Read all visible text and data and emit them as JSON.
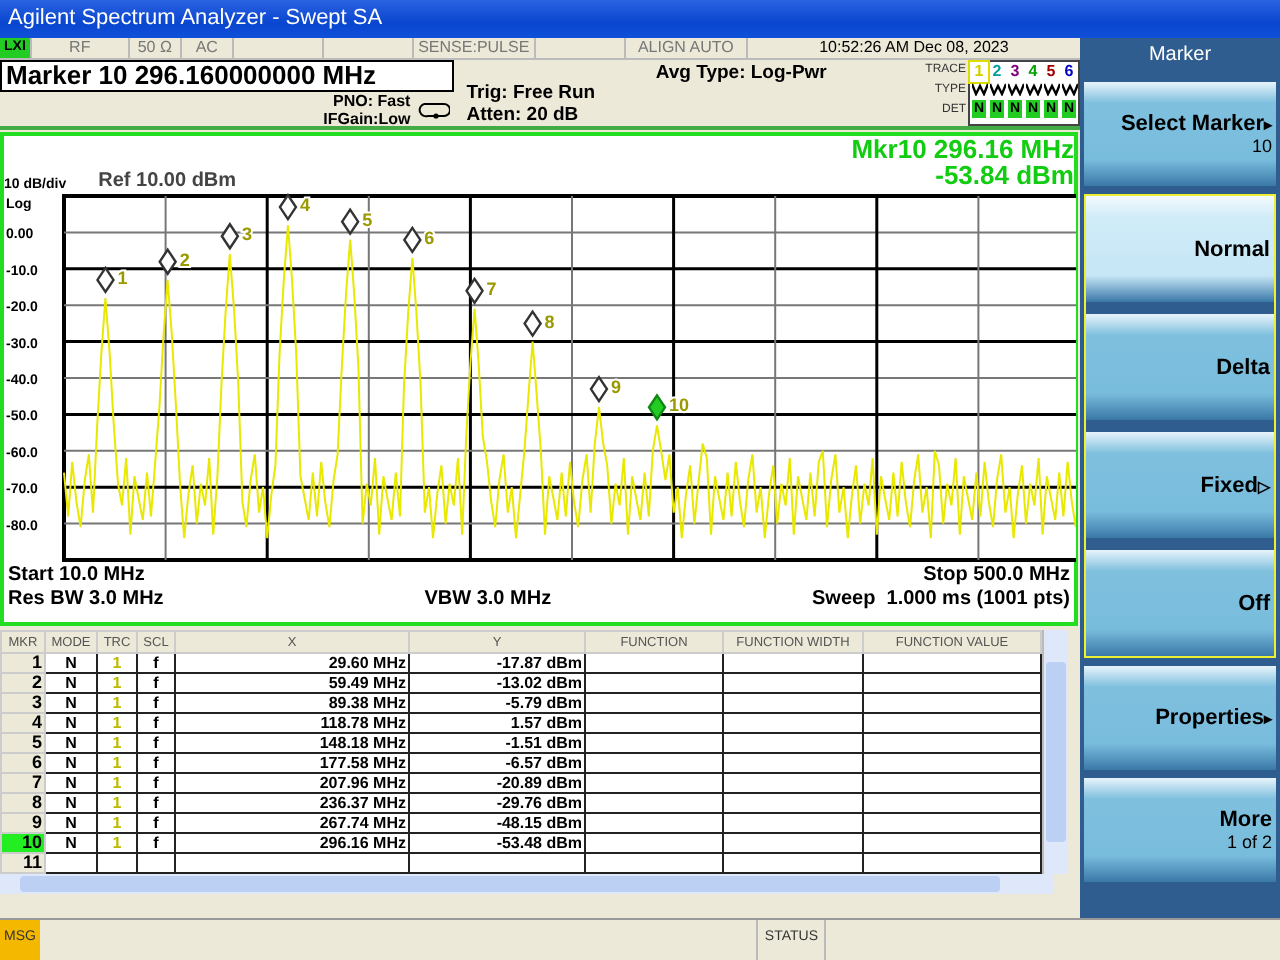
{
  "window": {
    "title": "Agilent Spectrum Analyzer - Swept SA"
  },
  "status_row": {
    "lxi": "LXI",
    "input": "RF",
    "impedance": "50 Ω",
    "coupling": "AC",
    "sense": "SENSE:PULSE",
    "align": "ALIGN AUTO",
    "datetime": "10:52:26 AM Dec 08, 2023"
  },
  "marker_readout": "Marker 10 296.160000000 MHz",
  "settings": {
    "pno": "PNO: Fast",
    "ifgain": "IFGain:Low",
    "trig": "Trig: Free Run",
    "atten": "Atten: 20 dB",
    "avg_type": "Avg Type: Log-Pwr"
  },
  "trace_panel": {
    "trace_label": "TRACE",
    "type_label": "TYPE",
    "det_label": "DET",
    "traces": [
      {
        "label": "1",
        "color": "#d0d000",
        "selected": true,
        "det": "N"
      },
      {
        "label": "2",
        "color": "#00a0a0",
        "selected": false,
        "det": "N"
      },
      {
        "label": "3",
        "color": "#800080",
        "selected": false,
        "det": "N"
      },
      {
        "label": "4",
        "color": "#00a000",
        "selected": false,
        "det": "N"
      },
      {
        "label": "5",
        "color": "#a00000",
        "selected": false,
        "det": "N"
      },
      {
        "label": "6",
        "color": "#0000c0",
        "selected": false,
        "det": "N"
      }
    ]
  },
  "graph": {
    "marker_freq": "Mkr10 296.16 MHz",
    "marker_level": "-53.84 dBm",
    "scale": "10 dB/div",
    "scale_type": "Log",
    "ref": "Ref 10.00 dBm",
    "start": "Start 10.0 MHz",
    "stop": "Stop 500.0 MHz",
    "rbw": "Res BW 3.0 MHz",
    "vbw": "VBW 3.0 MHz",
    "sweep": "Sweep  1.000 ms (1001 pts)",
    "chart_data": {
      "type": "line",
      "categories": [
        null,
        null,
        null,
        null,
        null,
        null,
        null,
        null,
        null,
        null,
        null,
        null,
        null,
        null,
        null,
        null,
        null,
        null,
        null,
        null,
        null,
        null,
        null,
        null,
        null,
        null,
        null,
        null,
        null,
        null,
        null,
        null,
        null,
        null,
        null,
        null,
        null,
        null,
        null,
        null,
        null,
        null,
        null,
        null,
        null,
        null,
        null,
        null,
        null,
        null,
        null,
        null,
        null,
        null,
        null,
        null,
        null,
        null,
        null,
        null,
        null,
        null,
        null,
        null,
        null,
        null,
        null,
        null,
        null,
        null,
        null,
        null,
        null,
        null,
        null,
        null,
        null,
        null,
        null,
        null,
        null,
        null,
        null,
        null,
        null,
        null,
        null,
        null,
        null,
        null,
        null,
        null,
        null,
        null,
        null,
        null,
        null,
        null,
        null,
        null,
        null,
        null,
        null,
        null,
        null,
        null,
        null,
        null,
        null,
        null,
        null,
        null,
        null,
        null,
        null,
        null,
        null,
        null,
        null,
        null,
        null,
        null,
        null,
        null,
        null,
        null,
        null,
        null,
        null,
        null,
        null,
        null,
        null,
        null,
        null,
        null,
        null,
        null,
        null,
        null,
        null,
        null,
        null,
        null,
        null,
        null,
        null,
        null,
        null,
        null,
        null,
        null,
        null,
        null,
        null,
        null,
        null,
        null,
        null,
        null,
        null,
        null,
        null,
        null,
        null,
        null,
        null,
        null,
        null,
        null,
        null,
        null,
        null,
        null,
        null,
        null,
        null,
        null,
        null,
        null,
        null,
        null,
        null,
        null,
        null,
        null,
        null,
        null,
        null,
        null,
        null,
        null,
        null,
        null,
        null,
        null,
        null,
        null,
        null,
        null,
        null,
        null,
        null,
        null,
        null,
        null,
        null,
        null,
        null,
        null,
        null,
        null,
        null,
        null,
        null,
        null,
        null,
        null,
        null,
        null,
        null,
        null,
        null,
        null,
        null,
        null,
        null,
        null,
        null,
        null,
        null,
        null,
        null,
        null,
        null,
        null,
        null,
        null,
        null,
        null,
        null,
        null,
        null,
        null,
        null,
        null
      ],
      "ylim": [
        -90,
        10
      ],
      "series": [
        {
          "color": "#e8e800",
          "values": [
            -66,
            -78,
            -63,
            -74,
            -81,
            -68,
            -61,
            -77,
            -53,
            -33,
            -18,
            -33,
            -53,
            -69,
            -75,
            -62,
            -83,
            -67,
            -73,
            -79,
            -66,
            -78,
            -63,
            -48,
            -28,
            -13,
            -28,
            -48,
            -70,
            -84,
            -72,
            -64,
            -80,
            -69,
            -75,
            -62,
            -83,
            -67,
            -41,
            -21,
            -6,
            -21,
            -41,
            -74,
            -81,
            -68,
            -61,
            -77,
            -70,
            -84,
            -72,
            -64,
            -33,
            -13,
            2,
            -13,
            -33,
            -67,
            -73,
            -79,
            -66,
            -78,
            -63,
            -74,
            -81,
            -68,
            -61,
            -37,
            -17,
            -2,
            -17,
            -37,
            -80,
            -69,
            -75,
            -62,
            -83,
            -67,
            -73,
            -79,
            -66,
            -78,
            -42,
            -22,
            -7,
            -22,
            -42,
            -77,
            -70,
            -84,
            -72,
            -64,
            -80,
            -69,
            -75,
            -62,
            -83,
            -56,
            -36,
            -21,
            -36,
            -56,
            -63,
            -74,
            -81,
            -68,
            -61,
            -77,
            -70,
            -84,
            -72,
            -60,
            -45,
            -30,
            -45,
            -60,
            -83,
            -67,
            -73,
            -79,
            -66,
            -78,
            -63,
            -74,
            -81,
            -68,
            -61,
            -77,
            -58,
            -48,
            -58,
            -64,
            -80,
            -69,
            -75,
            -62,
            -83,
            -67,
            -73,
            -79,
            -66,
            -78,
            -60,
            -53,
            -60,
            -68,
            -61,
            -77,
            -70,
            -84,
            -72,
            -64,
            -80,
            -69,
            -58,
            -62,
            -83,
            -67,
            -73,
            -79,
            -66,
            -78,
            -63,
            -74,
            -81,
            -68,
            -61,
            -77,
            -70,
            -84,
            -72,
            -64,
            -80,
            -69,
            -75,
            -62,
            -83,
            -67,
            -73,
            -79,
            -66,
            -78,
            -63,
            -60,
            -81,
            -68,
            -61,
            -77,
            -70,
            -84,
            -72,
            -64,
            -80,
            -69,
            -75,
            -62,
            -83,
            -67,
            -73,
            -79,
            -66,
            -78,
            -63,
            -74,
            -81,
            -68,
            -61,
            -77,
            -70,
            -84,
            -60,
            -64,
            -80,
            -69,
            -75,
            -62,
            -83,
            -67,
            -73,
            -79,
            -66,
            -78,
            -63,
            -74,
            -81,
            -68,
            -61,
            -77,
            -70,
            -84,
            -72,
            -64,
            -80,
            -69,
            -75,
            -62,
            -83,
            -67,
            -73,
            -79,
            -66,
            -78,
            -63,
            -74,
            -81,
            -68
          ]
        }
      ],
      "yticks": [
        {
          "value": 0,
          "label": "0.00"
        },
        {
          "value": -10,
          "label": "-10.0"
        },
        {
          "value": -20,
          "label": "-20.0"
        },
        {
          "value": -30,
          "label": "-30.0"
        },
        {
          "value": -40,
          "label": "-40.0"
        },
        {
          "value": -50,
          "label": "-50.0"
        },
        {
          "value": -60,
          "label": "-60.0"
        },
        {
          "value": -70,
          "label": "-70.0"
        },
        {
          "value": -80,
          "label": "-80.0"
        }
      ],
      "grid": true,
      "annotations": [
        {
          "text": "1"
        },
        {
          "text": "2"
        },
        {
          "text": "3"
        },
        {
          "text": "4"
        },
        {
          "text": "5"
        },
        {
          "text": "6"
        },
        {
          "text": "7"
        },
        {
          "text": "8"
        },
        {
          "text": "9"
        },
        {
          "text": "10"
        }
      ]
    }
  },
  "marker_table": {
    "columns": [
      "MKR",
      "MODE",
      "TRC",
      "SCL",
      "X",
      "Y",
      "FUNCTION",
      "FUNCTION WIDTH",
      "FUNCTION VALUE"
    ],
    "rows": [
      {
        "mkr": "1",
        "mode": "N",
        "trc": "1",
        "scl": "f",
        "x": "29.60 MHz",
        "y": "-17.87 dBm",
        "selected": false
      },
      {
        "mkr": "2",
        "mode": "N",
        "trc": "1",
        "scl": "f",
        "x": "59.49 MHz",
        "y": "-13.02 dBm",
        "selected": false
      },
      {
        "mkr": "3",
        "mode": "N",
        "trc": "1",
        "scl": "f",
        "x": "89.38 MHz",
        "y": "-5.79 dBm",
        "selected": false
      },
      {
        "mkr": "4",
        "mode": "N",
        "trc": "1",
        "scl": "f",
        "x": "118.78 MHz",
        "y": "1.57 dBm",
        "selected": false
      },
      {
        "mkr": "5",
        "mode": "N",
        "trc": "1",
        "scl": "f",
        "x": "148.18 MHz",
        "y": "-1.51 dBm",
        "selected": false
      },
      {
        "mkr": "6",
        "mode": "N",
        "trc": "1",
        "scl": "f",
        "x": "177.58 MHz",
        "y": "-6.57 dBm",
        "selected": false
      },
      {
        "mkr": "7",
        "mode": "N",
        "trc": "1",
        "scl": "f",
        "x": "207.96 MHz",
        "y": "-20.89 dBm",
        "selected": false
      },
      {
        "mkr": "8",
        "mode": "N",
        "trc": "1",
        "scl": "f",
        "x": "236.37 MHz",
        "y": "-29.76 dBm",
        "selected": false
      },
      {
        "mkr": "9",
        "mode": "N",
        "trc": "1",
        "scl": "f",
        "x": "267.74 MHz",
        "y": "-48.15 dBm",
        "selected": false
      },
      {
        "mkr": "10",
        "mode": "N",
        "trc": "1",
        "scl": "f",
        "x": "296.16 MHz",
        "y": "-53.48 dBm",
        "selected": true
      },
      {
        "mkr": "11",
        "selected": false
      }
    ]
  },
  "softkeys": {
    "title": "Marker",
    "keys": [
      {
        "kind": "key",
        "label": "Select Marker",
        "value": "10",
        "arrow": "▸"
      },
      {
        "kind": "radio_group",
        "options": [
          {
            "label": "Normal",
            "selected": true
          },
          {
            "label": "Delta",
            "selected": false
          },
          {
            "label": "Fixed",
            "arrow": "▷",
            "selected": false
          },
          {
            "label": "Off",
            "selected": false
          }
        ]
      },
      {
        "kind": "key",
        "label": "Properties",
        "arrow": "▸"
      },
      {
        "kind": "key",
        "label": "More",
        "value": "1 of 2"
      }
    ]
  },
  "status_bar": {
    "msg": "MSG",
    "status": "STATUS"
  }
}
